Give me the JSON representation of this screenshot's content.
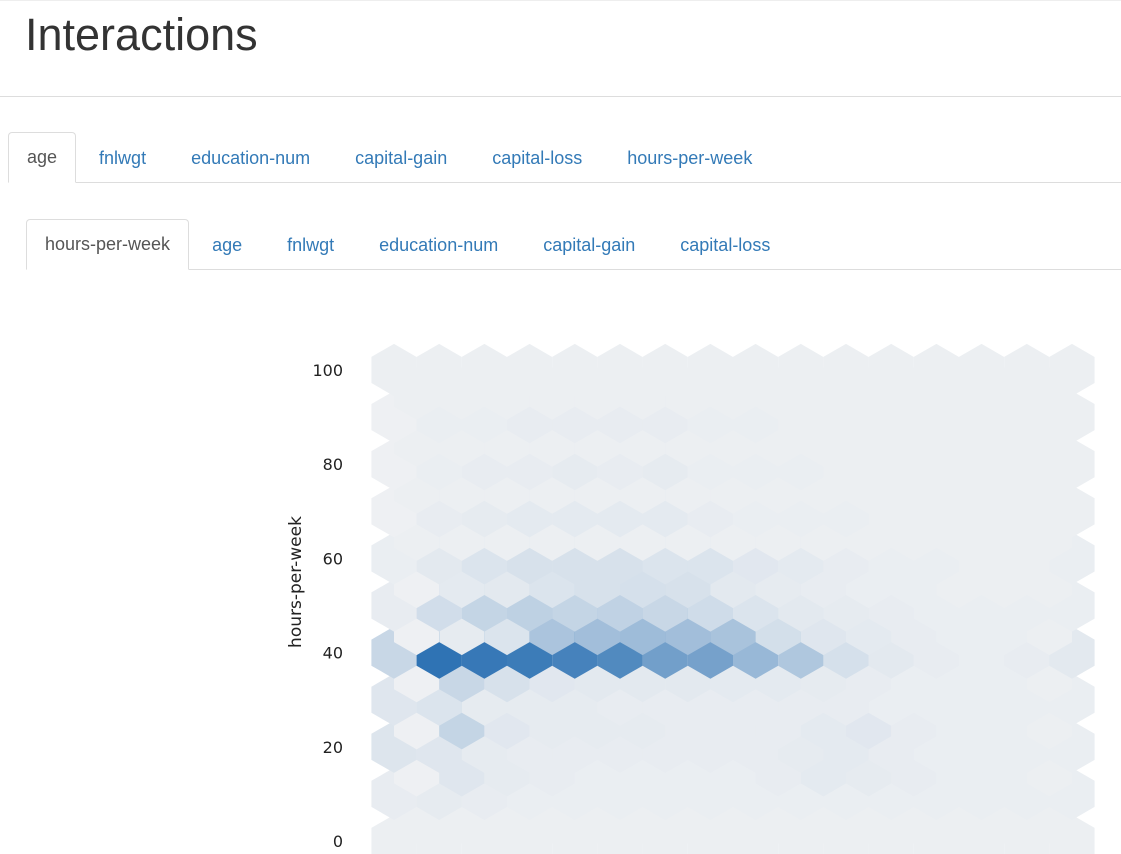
{
  "page": {
    "title": "Interactions"
  },
  "outer_tabs": [
    {
      "label": "age",
      "active": true
    },
    {
      "label": "fnlwgt",
      "active": false
    },
    {
      "label": "education-num",
      "active": false
    },
    {
      "label": "capital-gain",
      "active": false
    },
    {
      "label": "capital-loss",
      "active": false
    },
    {
      "label": "hours-per-week",
      "active": false
    }
  ],
  "inner_tabs": [
    {
      "label": "hours-per-week",
      "active": true
    },
    {
      "label": "age",
      "active": false
    },
    {
      "label": "fnlwgt",
      "active": false
    },
    {
      "label": "education-num",
      "active": false
    },
    {
      "label": "capital-gain",
      "active": false
    },
    {
      "label": "capital-loss",
      "active": false
    }
  ],
  "colors": {
    "link": "#337ab7",
    "active_tab_text": "#555555",
    "hex_low": "#eef0f3",
    "hex_high": "#2f73b4"
  },
  "chart_data": {
    "type": "heatmap",
    "subtype": "hexbin",
    "ylabel": "hours-per-week",
    "xlabel": "",
    "ylim": [
      0,
      100
    ],
    "yticks": [
      "100",
      "80",
      "60",
      "40",
      "20",
      "0"
    ],
    "cell_values": {
      "40": [
        0.2,
        1.0,
        0.96,
        0.93,
        0.88,
        0.82,
        0.65,
        0.63,
        0.45,
        0.33,
        0.13,
        0.06,
        0.03,
        0.02,
        0.03,
        0.06
      ],
      "45": [
        0.0,
        0.04,
        0.1,
        0.35,
        0.4,
        0.42,
        0.4,
        0.36,
        0.14,
        0.08,
        0.05,
        0.03,
        0.02,
        0.02,
        0.01
      ],
      "50": [
        0.03,
        0.15,
        0.22,
        0.25,
        0.22,
        0.24,
        0.2,
        0.16,
        0.1,
        0.06,
        0.04,
        0.03,
        0.02,
        0.02,
        0.02,
        0.02
      ],
      "55": [
        0.0,
        0.05,
        0.06,
        0.1,
        0.12,
        0.13,
        0.12,
        0.06,
        0.04,
        0.03,
        0.02,
        0.02,
        0.01,
        0.01,
        0.01
      ],
      "60": [
        0.02,
        0.06,
        0.1,
        0.12,
        0.12,
        0.12,
        0.1,
        0.1,
        0.07,
        0.05,
        0.03,
        0.02,
        0.02,
        0.01,
        0.01,
        0.02
      ],
      "35": [
        0.0,
        0.2,
        0.12,
        0.07,
        0.06,
        0.06,
        0.06,
        0.05,
        0.05,
        0.04,
        0.03,
        0.02,
        0.02,
        0.02,
        0.01
      ],
      "30": [
        0.08,
        0.1,
        0.04,
        0.04,
        0.04,
        0.03,
        0.03,
        0.03,
        0.03,
        0.03,
        0.03,
        0.02,
        0.02,
        0.02,
        0.02,
        0.02
      ],
      "25": [
        0.0,
        0.22,
        0.07,
        0.04,
        0.04,
        0.04,
        0.03,
        0.03,
        0.03,
        0.05,
        0.07,
        0.03,
        0.02,
        0.02,
        0.01
      ],
      "20": [
        0.09,
        0.08,
        0.04,
        0.03,
        0.03,
        0.03,
        0.03,
        0.03,
        0.03,
        0.04,
        0.05,
        0.03,
        0.02,
        0.02,
        0.02,
        0.02
      ],
      "15": [
        0.0,
        0.08,
        0.04,
        0.03,
        0.02,
        0.02,
        0.02,
        0.02,
        0.03,
        0.05,
        0.04,
        0.03,
        0.02,
        0.02,
        0.01
      ],
      "10": [
        0.03,
        0.04,
        0.03,
        0.02,
        0.02,
        0.02,
        0.02,
        0.02,
        0.02,
        0.02,
        0.02,
        0.02,
        0.02,
        0.02,
        0.02,
        0.02
      ],
      "70": [
        0.0,
        0.03,
        0.04,
        0.05,
        0.05,
        0.05,
        0.05,
        0.03,
        0.02,
        0.02,
        0.02,
        0.01,
        0.01,
        0.01,
        0.01
      ],
      "80": [
        0.0,
        0.02,
        0.03,
        0.03,
        0.04,
        0.03,
        0.04,
        0.02,
        0.02,
        0.02,
        0.01,
        0.01,
        0.01,
        0.01,
        0.01
      ],
      "90": [
        0.0,
        0.02,
        0.02,
        0.03,
        0.03,
        0.03,
        0.03,
        0.02,
        0.02,
        0.01,
        0.01,
        0.01,
        0.01,
        0.01,
        0.01
      ]
    }
  }
}
